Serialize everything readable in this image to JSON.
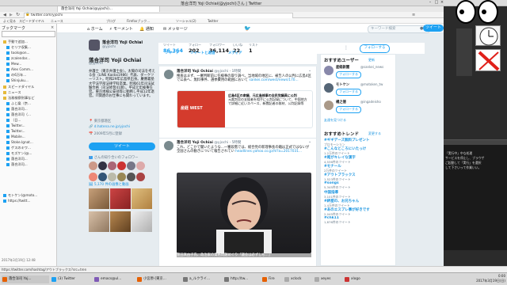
{
  "window": {
    "title": "落合洋司 Yoji Ochiai(@yjochi)さん | Twitter"
  },
  "tabs": {
    "active": "落合洋司 Yoji Ochiai(@yjochi)..."
  },
  "address": {
    "url": "twitter.com/yjochi"
  },
  "bookmarks_bar": [
    "よく見る",
    "スピードダイヤル",
    "ニュース",
    "ブログ",
    "Firefoxブック...",
    "ソーシャル(2)",
    "Twitter"
  ],
  "sidebar": {
    "title": "ブックマーク",
    "items": [
      {
        "label": "手動で追加..."
      },
      {
        "label": "セリフ収集..."
      },
      {
        "label": "tools@on..."
      },
      {
        "label": "zcalendar..."
      },
      {
        "label": "Mew..."
      },
      {
        "label": "Alex Comm..."
      },
      {
        "label": "の6万年..."
      },
      {
        "label": "Shinjuku..."
      },
      {
        "label": "スピードダイヤル"
      },
      {
        "label": "ニュース"
      },
      {
        "label": "法務検察刑事など"
      },
      {
        "label": "ふじ楽（京..."
      },
      {
        "label": "落合洋司..."
      },
      {
        "label": "落合洋司（..."
      },
      {
        "label": "（日..."
      },
      {
        "label": "Twitter..."
      },
      {
        "label": "Twitter..."
      },
      {
        "label": "Mobile..."
      },
      {
        "label": "Stoke.Ignat..."
      },
      {
        "label": "ゲスのキワ..."
      },
      {
        "label": "モズケン(@..."
      },
      {
        "label": "落合洋司..."
      },
      {
        "label": "落合洋司..."
      },
      {
        "label": "モトケン(@moto..."
      },
      {
        "label": "https://twitt..."
      }
    ],
    "footer_date": "2017年3月19日 12:48"
  },
  "twitter_nav": {
    "home": "ホーム",
    "moments": "モーメント",
    "notifications": "通知",
    "messages": "メッセージ",
    "search_placeholder": "キーワード検索",
    "tweet_button": "ツイート"
  },
  "profile": {
    "name": "落合洋司 Yoji Ochiai",
    "handle": "@yjochi",
    "bio": "弁護士（東京弁護士会）。太陽の司法を考える会（LINE Kaidai1986）代表、ダークツーリスト。昭和29年広島県出身。慶應義塾大学法学部法律学科卒業。昭和61年司法試験合格（司法修習41期）。平成元年検事任官。東京地検公安部等に勤務し平成12年退官。IT関連のお仕事にも関わっています。",
    "location": "東京都港区",
    "website": "d.hatena.ne.jp/yjochi",
    "joined": "2009年5月に登録",
    "tweet_button": "ツイート",
    "known_followers": "さんの知り合いのフォロワー",
    "photos_label": "5,170 件の画像と動画"
  },
  "stats": [
    {
      "label": "ツイート",
      "value": "86,364"
    },
    {
      "label": "フォロー",
      "value": "202"
    },
    {
      "label": "フォロワー",
      "value": "36,114"
    },
    {
      "label": "いいね",
      "value": "22"
    },
    {
      "label": "リスト",
      "value": "1"
    }
  ],
  "follow_button": "フォローする",
  "feed_tabs": [
    "ツイート",
    "ツイートと返信",
    "メディア"
  ],
  "tweets": [
    {
      "name": "落合洋司 Yoji Ochiai",
      "handle": "@yjochi",
      "time": "1時間",
      "text": "捜査はまず、一審判断前に任検事の取り調べ、当地域の地区に、被告人の公判に広島4区で公表へ、無料事件、選挙費用の範囲において",
      "link": "sankei.com/west/news/170...",
      "card_label": "産経 WEST",
      "card_title": "広島4区の衆議、元広島検事の自民党議員に公判",
      "card_text": "元裁判官の支援者を相手に公判記録について、中国地方で詳細に近いスペース、新聞記者の取材、公判記録等"
    },
    {
      "name": "落合洋司 Yoji Ochiai",
      "handle": "@yjochi",
      "time": "5時間",
      "text": "これ、どこかで聞いたような...一審段階では、総合党の新理事長の籍は正式ではないが全国さんの動きについて報告されてい",
      "link": "headlines.yahoo.co.jp/hl?a=2017031..."
    }
  ],
  "photo_caption": "豊田真由子氏、政治家の資格問題めぐり「議会は必ずしも...」",
  "who_to_follow": {
    "title": "おすすめユーザー",
    "refresh": "更新",
    "users": [
      {
        "name": "産経新聞",
        "handle": "@sankei_news",
        "button": "フォローする"
      },
      {
        "name": "モトケン",
        "handle": "@motoken_tw",
        "button": "フォローする"
      },
      {
        "name": "楊之徳",
        "handle": "@ingadeisho",
        "button": "フォローする"
      }
    ],
    "find_friends": "友達を見つける"
  },
  "trends": {
    "title": "おすすめトレンド",
    "change": "変更する",
    "items": [
      {
        "name": "#ギギデーズ無料プレゼント",
        "count": "プロモーション"
      },
      {
        "name": "#こんなところにいたっけ",
        "count": "1.2万件のツイート"
      },
      {
        "name": "#尾がキレイな漢字",
        "count": "4,536件のツイート"
      },
      {
        "name": "#モナール",
        "count": "2万件のツイート"
      },
      {
        "name": "#アウトブラックス",
        "count": "1,523件のツイート"
      },
      {
        "name": "#songs",
        "count": "5,345件のツイート"
      },
      {
        "name": "中国指導",
        "count": "3,101件のツイート"
      },
      {
        "name": "#絆屋の、お兄ちゃん",
        "count": "1.4万件のツイート"
      },
      {
        "name": "#あのエスプレ事が好きです",
        "count": "2,045件のツイート"
      },
      {
        "name": "#chk11",
        "count": "1,876件のツイート"
      }
    ]
  },
  "desktop": {
    "terminal_lines": [
      "「実行中」中な処理",
      "サービスを停止し、ブラウザ",
      "ご起動して「実行」を選択",
      "して下さいって作業いい。"
    ]
  },
  "status": {
    "text": "https://twitter.com/hashtag/アウトブラックス?src=tren"
  },
  "taskbar": {
    "tasks": [
      "落合洋司 Yoj...",
      "(3) Twitter",
      "emacs@ul...",
      "小宮原-[東京...",
      "a_ルクライ...",
      "http://tw...",
      "Fire",
      "xclock",
      "xeyes",
      "xlogo"
    ],
    "time": "0:00",
    "date": "2017年3月19日(日)"
  },
  "colors": {
    "twitter_blue": "#1da1f2",
    "link_blue": "#1b95e0"
  }
}
